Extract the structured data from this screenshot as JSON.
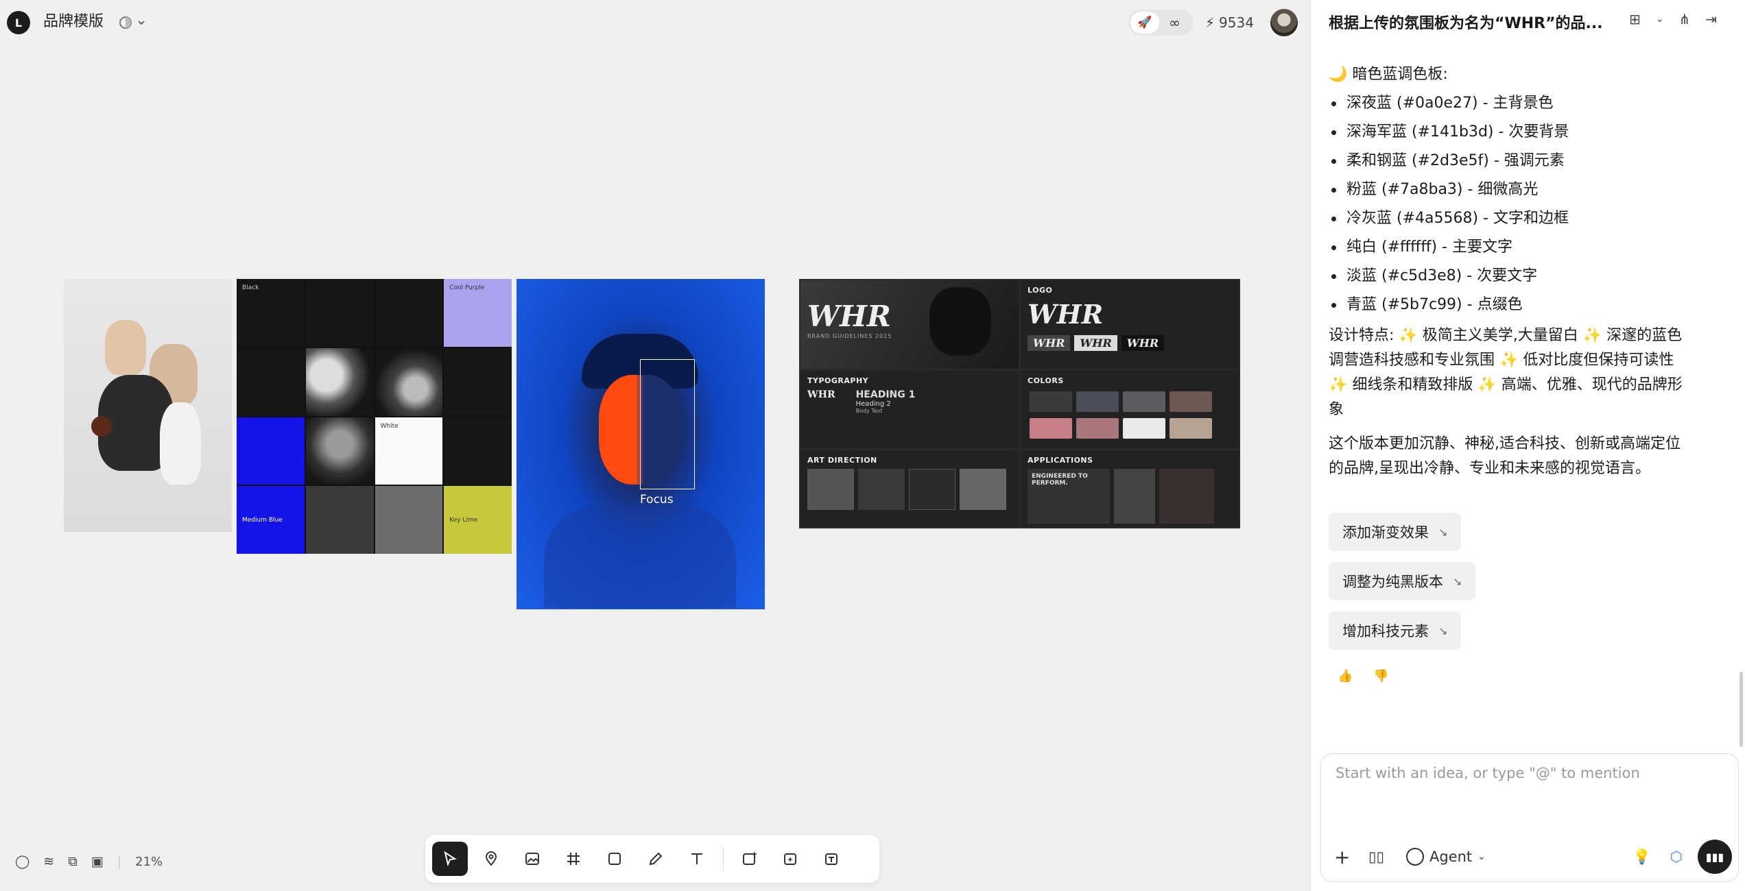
{
  "app": {
    "logo": "L",
    "project_title": "品牌模版",
    "brand_icon": "palette-icon"
  },
  "topbar": {
    "credits": "9534",
    "rocket_icon": "rocket-icon",
    "infinity_icon": "infinity-icon",
    "bolt_icon": "bolt-icon"
  },
  "canvas": {
    "robot_labels": {
      "black": "Black",
      "cool_purple": "Cool Purple",
      "white": "White",
      "medium_blue": "Medium Blue",
      "key_lime": "Key Lime"
    },
    "focus_label": "Focus",
    "guide": {
      "logo": "LOGO",
      "typography": "TYPOGRAPHY",
      "colors": "COLORS",
      "art_direction": "ART DIRECTION",
      "applications": "APPLICATIONS",
      "whr": "WHR",
      "brand_guidelines": "BRAND GUIDELINES 2025",
      "heading1": "HEADING 1",
      "heading2": "Heading 2",
      "body_text": "Body Text",
      "engineered": "ENGINEERED TO PERFORM."
    },
    "zoom": "21%"
  },
  "toolbar": {
    "tools": [
      "select-tool",
      "pin-tool",
      "image-tool",
      "frame-tool",
      "rectangle-tool",
      "pen-tool",
      "text-tool",
      "image-gen-tool",
      "image-edit-tool",
      "text-gen-tool"
    ]
  },
  "chat": {
    "title": "根据上传的氛围板为名为“WHR”的品...",
    "section_heading": "🌙 暗色蓝调色板:",
    "palette": [
      "深夜蓝 (#0a0e27) - 主背景色",
      "深海军蓝 (#141b3d) - 次要背景",
      "柔和钢蓝 (#2d3e5f) - 强调元素",
      "粉蓝 (#7a8ba3) - 细微高光",
      "冷灰蓝 (#4a5568) - 文字和边框",
      "纯白 (#ffffff) - 主要文字",
      "淡蓝 (#c5d3e8) - 次要文字",
      "青蓝 (#5b7c99) - 点缀色"
    ],
    "features": "设计特点: ✨ 极简主义美学,大量留白 ✨ 深邃的蓝色调营造科技感和专业氛围 ✨ 低对比度但保持可读性 ✨ 细线条和精致排版 ✨ 高端、优雅、现代的品牌形象",
    "summary": "这个版本更加沉静、神秘,适合科技、创新或高端定位的品牌,呈现出冷静、专业和未来感的视觉语言。",
    "suggestions": [
      "添加渐变效果",
      "调整为纯黑版本",
      "增加科技元素"
    ],
    "input_placeholder": "Start with an idea, or type \"@\" to mention",
    "agent_label": "Agent"
  },
  "colors": {
    "accent_dark": "#1f1f1f",
    "swatches": [
      "#c87e86",
      "#a9767b",
      "#c5c5c5",
      "#e9e9e9",
      "#b7a394",
      "#5b5c60"
    ]
  }
}
